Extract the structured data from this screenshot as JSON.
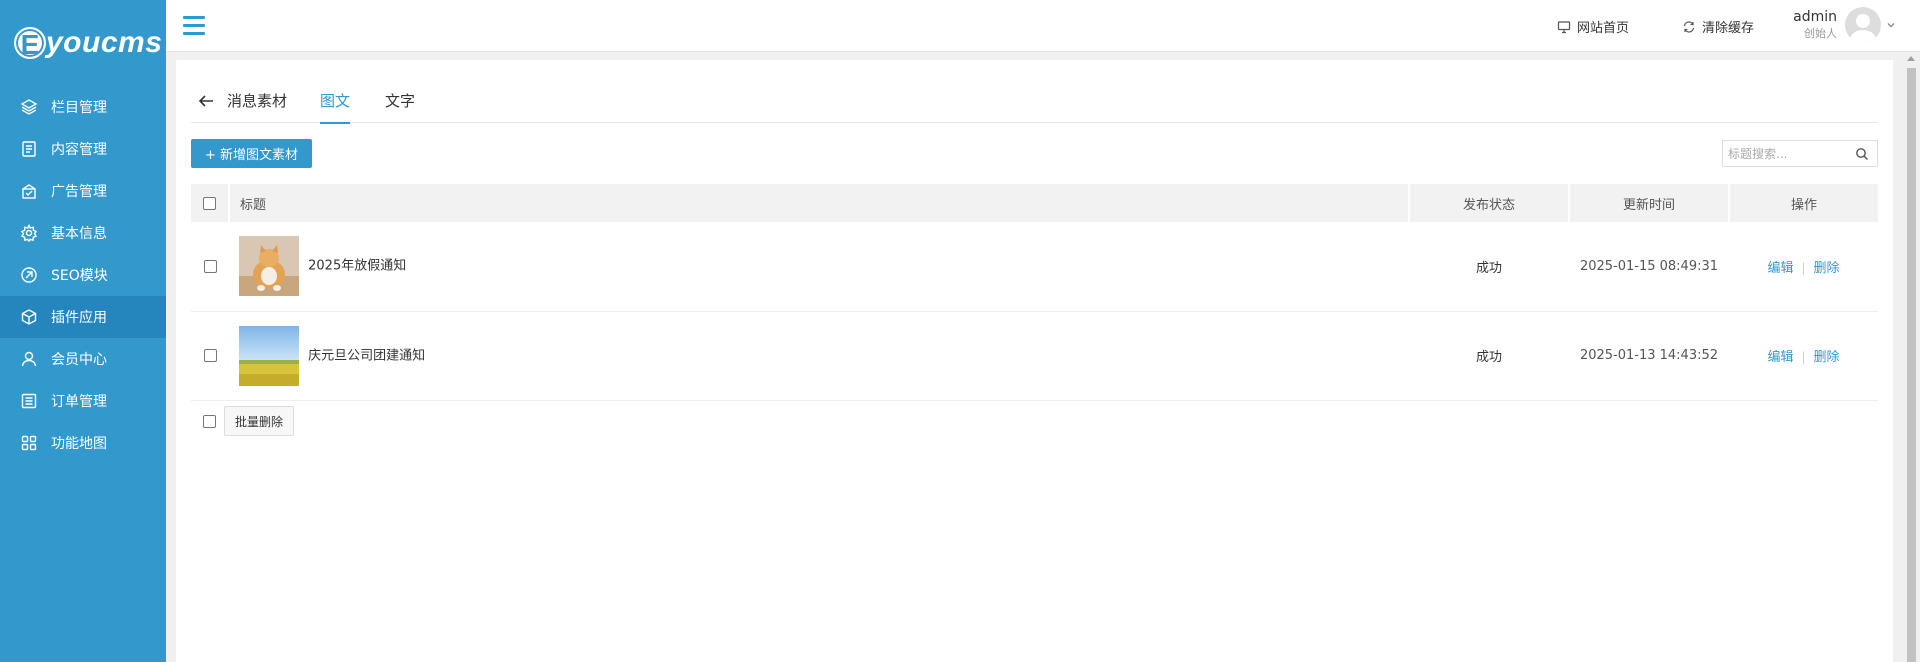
{
  "brand": {
    "logo_letter": "E",
    "logo_text": "youcms"
  },
  "sidebar": {
    "items": [
      {
        "label": "栏目管理",
        "icon": "layers-icon",
        "active": false
      },
      {
        "label": "内容管理",
        "icon": "document-icon",
        "active": false
      },
      {
        "label": "广告管理",
        "icon": "ad-icon",
        "active": false
      },
      {
        "label": "基本信息",
        "icon": "gear-icon",
        "active": false
      },
      {
        "label": "SEO模块",
        "icon": "seo-icon",
        "active": false
      },
      {
        "label": "插件应用",
        "icon": "cube-icon",
        "active": true
      },
      {
        "label": "会员中心",
        "icon": "user-icon",
        "active": false
      },
      {
        "label": "订单管理",
        "icon": "list-icon",
        "active": false
      },
      {
        "label": "功能地图",
        "icon": "grid-icon",
        "active": false
      }
    ]
  },
  "header": {
    "site_home": "网站首页",
    "clear_cache": "清除缓存",
    "user_name": "admin",
    "user_role": "创始人"
  },
  "tabs": {
    "title": "消息素材",
    "items": [
      {
        "label": "图文",
        "active": true
      },
      {
        "label": "文字",
        "active": false
      }
    ]
  },
  "toolbar": {
    "add_label": "+ 新增图文素材",
    "search_placeholder": "标题搜索..."
  },
  "table": {
    "columns": [
      "标题",
      "发布状态",
      "更新时间",
      "操作"
    ],
    "rows": [
      {
        "title": "2025年放假通知",
        "thumb": "cat",
        "status": "成功",
        "updated": "2025-01-15 08:49:31",
        "edit": "编辑",
        "delete": "删除"
      },
      {
        "title": "庆元旦公司团建通知",
        "thumb": "field",
        "status": "成功",
        "updated": "2025-01-13 14:43:52",
        "edit": "编辑",
        "delete": "删除"
      }
    ],
    "separator": "|"
  },
  "batch": {
    "delete_label": "批量删除"
  },
  "colors": {
    "primary": "#3398cc",
    "sidebar_active": "#2486bd"
  }
}
